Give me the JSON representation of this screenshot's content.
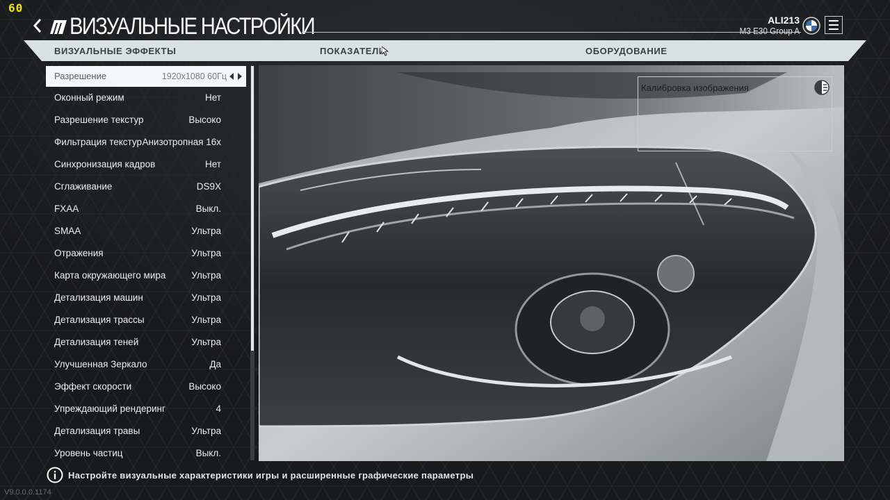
{
  "fps": "60",
  "header": {
    "title": "ВИЗУАЛЬНЫЕ НАСТРОЙКИ",
    "user_name": "ALI213",
    "car_name": "M3 E30 Group A"
  },
  "tabs": [
    {
      "label": "ВИЗУАЛЬНЫЕ ЭФФЕКТЫ"
    },
    {
      "label": "ПОКАЗАТЕЛИ"
    },
    {
      "label": "ОБОРУДОВАНИЕ"
    }
  ],
  "settings": [
    {
      "label": "Разрешение",
      "value": "1920x1080 60Гц"
    },
    {
      "label": "Оконный режим",
      "value": "Нет"
    },
    {
      "label": "Разрешение текстур",
      "value": "Высоко"
    },
    {
      "label": "Фильтрация текстур",
      "value": "Анизотропная 16x"
    },
    {
      "label": "Синхронизация кадров",
      "value": "Нет"
    },
    {
      "label": "Сглаживание",
      "value": "DS9X"
    },
    {
      "label": "FXAA",
      "value": "Выкл."
    },
    {
      "label": "SMAA",
      "value": "Ультра"
    },
    {
      "label": "Отражения",
      "value": "Ультра"
    },
    {
      "label": "Карта окружающего мира",
      "value": "Ультра"
    },
    {
      "label": "Детализация машин",
      "value": "Ультра"
    },
    {
      "label": "Детализация трассы",
      "value": "Ультра"
    },
    {
      "label": "Детализация теней",
      "value": "Ультра"
    },
    {
      "label": "Улучшенная Зеркало",
      "value": "Да"
    },
    {
      "label": "Эффект скорости",
      "value": "Высоко"
    },
    {
      "label": "Упреждающий рендеринг",
      "value": "4"
    },
    {
      "label": "Детализация травы",
      "value": "Ультра"
    },
    {
      "label": "Уровень частиц",
      "value": "Выкл."
    }
  ],
  "preview": {
    "calibration_label": "Калибровка изображения"
  },
  "footer": {
    "hint": "Настройте визуальные характеристики игры и расширенные графические параметры",
    "version": "V9.0.0.0.1174"
  },
  "colors": {
    "fps": "#f2e600",
    "tab_bar": "#d8e1e4",
    "selected_row": "#f4f6f7",
    "background": "#1c1d20"
  },
  "icons": [
    "back-arrow-icon",
    "game-logo-icon",
    "bmw-badge-icon",
    "hamburger-menu-icon",
    "mouse-cursor-icon",
    "calibration-toggle-icon",
    "info-icon",
    "arrow-left-icon",
    "arrow-right-icon"
  ]
}
